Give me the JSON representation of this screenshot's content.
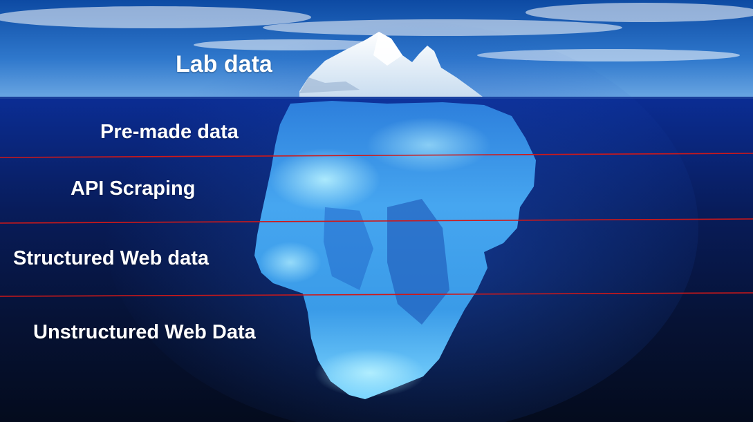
{
  "layers": [
    {
      "label": "Lab data"
    },
    {
      "label": "Pre-made data"
    },
    {
      "label": "API Scraping"
    },
    {
      "label": "Structured Web data"
    },
    {
      "label": "Unstructured Web Data"
    }
  ],
  "colors": {
    "sky_top": "#0f4fa8",
    "sky_bottom": "#5b9de0",
    "water_top": "#0a2a8a",
    "water_bottom": "#040a1a",
    "ice_light": "#8fe6ff",
    "ice_dark": "#1f6fd0",
    "divider": "#d01818"
  }
}
